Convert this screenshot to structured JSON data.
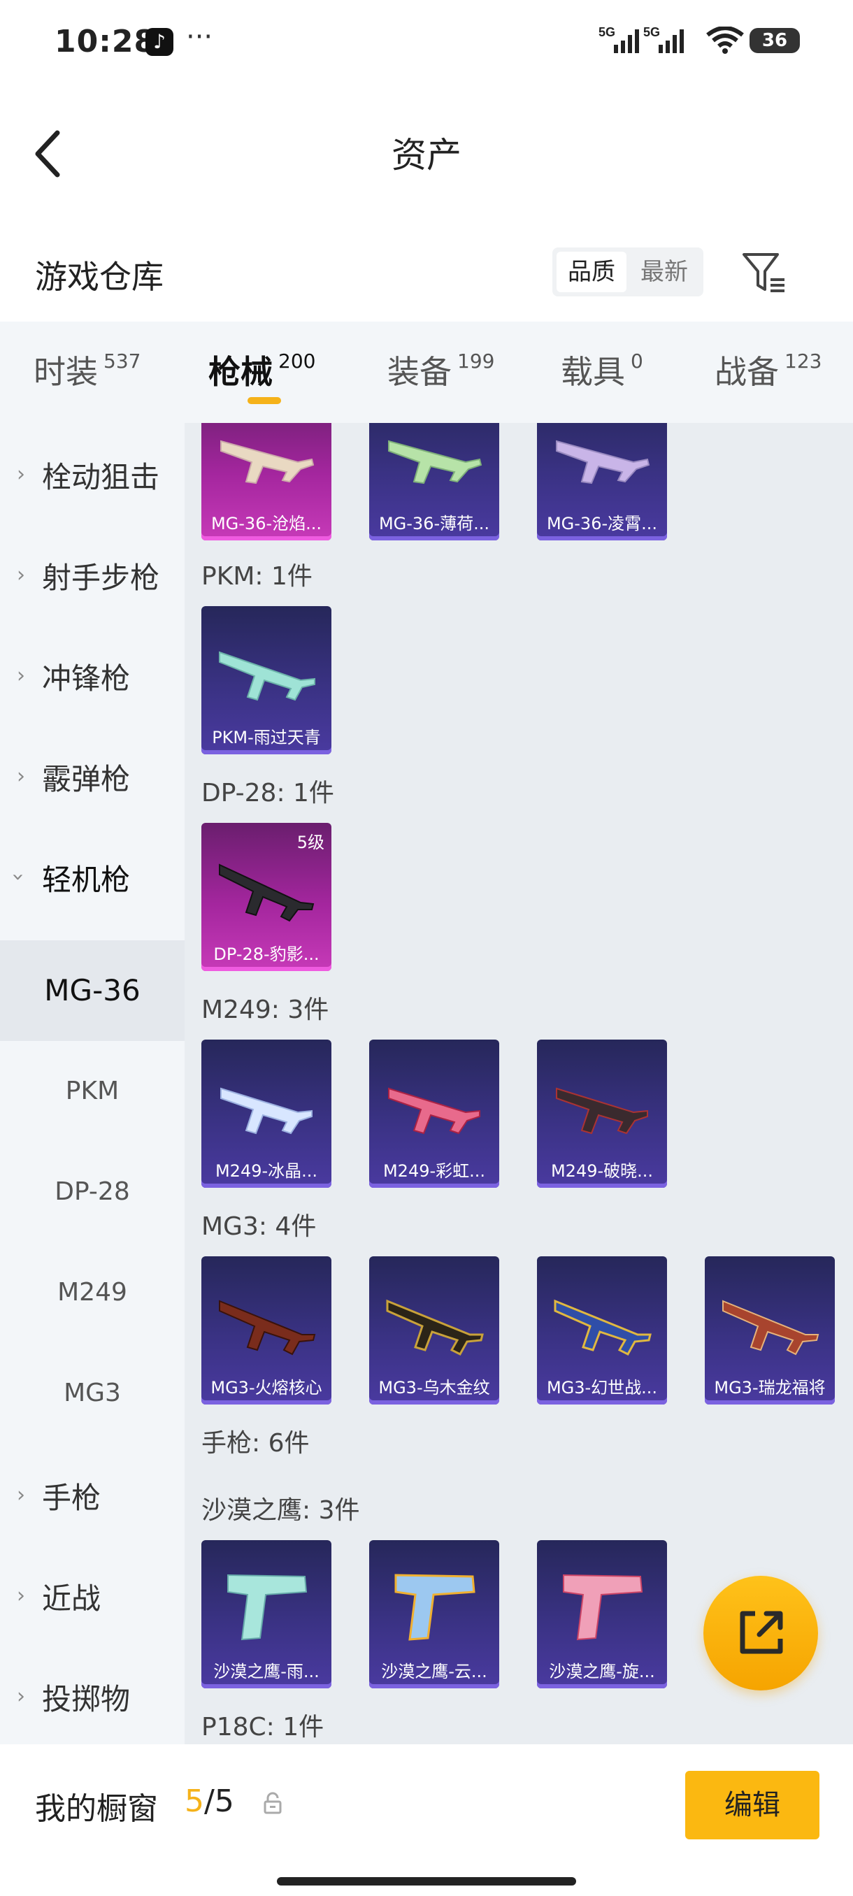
{
  "status_bar": {
    "time": "10:28",
    "dots": "···",
    "net1": "5G",
    "net2": "5G",
    "battery": "36"
  },
  "header": {
    "title": "资产"
  },
  "warehouse": {
    "title": "游戏仓库",
    "sort_options": [
      "品质",
      "最新"
    ],
    "sort_active": 0
  },
  "tabs": [
    {
      "label": "时装",
      "count": "537"
    },
    {
      "label": "枪械",
      "count": "200"
    },
    {
      "label": "装备",
      "count": "199"
    },
    {
      "label": "载具",
      "count": "0"
    },
    {
      "label": "战备",
      "count": "123"
    }
  ],
  "active_tab": 1,
  "sidebar": {
    "categories": [
      {
        "label": "栓动狙击",
        "expanded": false
      },
      {
        "label": "射手步枪",
        "expanded": false
      },
      {
        "label": "冲锋枪",
        "expanded": false
      },
      {
        "label": "霰弹枪",
        "expanded": false
      },
      {
        "label": "轻机枪",
        "expanded": true
      }
    ],
    "subitems": [
      "MG-36",
      "PKM",
      "DP-28",
      "M249",
      "MG3"
    ],
    "active_sub": "MG-36",
    "more_categories": [
      "手枪",
      "近战",
      "投掷物"
    ]
  },
  "groups": {
    "mg36": {
      "cards": [
        "MG-36-沧焰...",
        "MG-36-薄荷...",
        "MG-36-凌霄..."
      ]
    },
    "pkm": {
      "title": "PKM: 1件",
      "cards": [
        "PKM-雨过天青"
      ]
    },
    "dp28": {
      "title": "DP-28: 1件",
      "cards": [
        "DP-28-豹影..."
      ],
      "level": "5级"
    },
    "m249": {
      "title": "M249: 3件",
      "cards": [
        "M249-冰晶...",
        "M249-彩虹...",
        "M249-破晓..."
      ]
    },
    "mg3": {
      "title": "MG3: 4件",
      "cards": [
        "MG3-火熔核心",
        "MG3-乌木金纹",
        "MG3-幻世战...",
        "MG3-瑞龙福将"
      ]
    },
    "pistol": {
      "title": "手枪: 6件"
    },
    "deagle": {
      "title": "沙漠之鹰: 3件",
      "cards": [
        "沙漠之鹰-雨...",
        "沙漠之鹰-云...",
        "沙漠之鹰-旋..."
      ]
    },
    "p18c": {
      "title": "P18C: 1件"
    }
  },
  "showcase": {
    "title": "我的橱窗",
    "current": "5",
    "sep": "/",
    "total": "5",
    "edit_label": "编辑"
  },
  "colors": {
    "accent": "#f5b21a",
    "card_purple": "#3a3284",
    "card_pink": "#a4269e"
  }
}
